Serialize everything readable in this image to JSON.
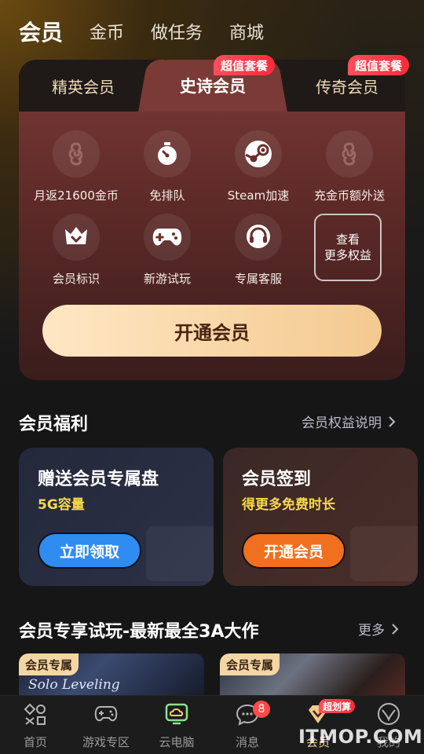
{
  "top_nav": {
    "tabs": [
      {
        "label": "会员",
        "active": true
      },
      {
        "label": "金币",
        "active": false
      },
      {
        "label": "做任务",
        "active": false
      },
      {
        "label": "商城",
        "active": false
      }
    ]
  },
  "membership": {
    "tiers": [
      {
        "label": "精英会员",
        "badge": ""
      },
      {
        "label": "史诗会员",
        "badge": "超值套餐",
        "active": true
      },
      {
        "label": "传奇会员",
        "badge": "超值套餐"
      }
    ],
    "benefits": [
      {
        "label": "月返21600金币",
        "icon": "coin-icon"
      },
      {
        "label": "免排队",
        "icon": "stopwatch-icon"
      },
      {
        "label": "Steam加速",
        "icon": "steam-icon"
      },
      {
        "label": "充金币额外送",
        "icon": "coin-icon"
      },
      {
        "label": "会员标识",
        "icon": "crown-badge-icon"
      },
      {
        "label": "新游试玩",
        "icon": "gamepad-icon"
      },
      {
        "label": "专属客服",
        "icon": "headset-icon"
      }
    ],
    "more_benefits": {
      "line1": "查看",
      "line2": "更多权益"
    },
    "open_button": "开通会员"
  },
  "welfare": {
    "title": "会员福利",
    "link": "会员权益说明",
    "cards": [
      {
        "title": "赠送会员专属盘",
        "subtitle": "5G容量",
        "subtitle_color": "#f7d84a",
        "button": "立即领取",
        "button_color": "#2f8cf0"
      },
      {
        "title": "会员签到",
        "subtitle": "得更多免费时长",
        "subtitle_color": "#f7d84a",
        "button": "开通会员",
        "button_color": "#f07020"
      }
    ]
  },
  "trial": {
    "title": "会员专享试玩-最新最全3A大作",
    "link": "更多",
    "games": [
      {
        "tag": "会员专属",
        "title": "Solo Leveling"
      },
      {
        "tag": "会员专属",
        "title": ""
      }
    ]
  },
  "bottom_nav": {
    "items": [
      {
        "label": "首页",
        "icon": "home-grid-icon"
      },
      {
        "label": "游戏专区",
        "icon": "gamepad-icon"
      },
      {
        "label": "云电脑",
        "icon": "cloud-pc-icon"
      },
      {
        "label": "消息",
        "icon": "message-icon",
        "count": "8"
      },
      {
        "label": "会员",
        "icon": "vip-diamond-icon",
        "badge": "超划算",
        "active": true
      },
      {
        "label": "我的",
        "icon": "profile-icon"
      }
    ]
  },
  "watermark": "ITMOP.COM",
  "colors": {
    "accent": "#f3c98f",
    "badge_red": "#ff2a3a",
    "card_red": "#7a3a36"
  }
}
